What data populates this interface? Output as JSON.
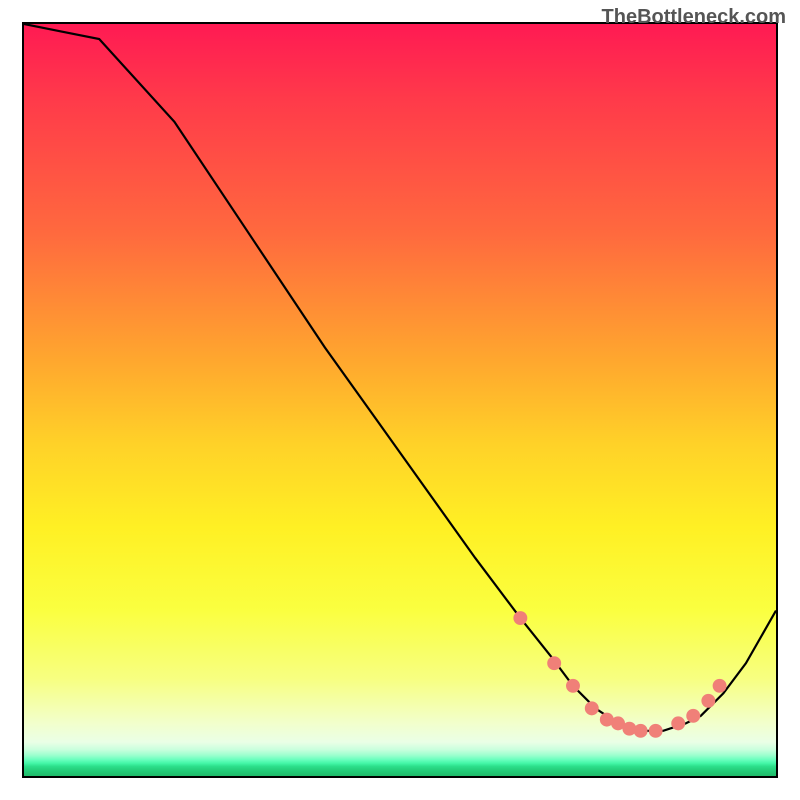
{
  "watermark": "TheBottleneck.com",
  "chart_data": {
    "type": "line",
    "title": "",
    "xlabel": "",
    "ylabel": "",
    "xlim": [
      0,
      100
    ],
    "ylim": [
      0,
      100
    ],
    "series": [
      {
        "name": "curve",
        "x": [
          0,
          5,
          10,
          20,
          30,
          40,
          50,
          60,
          66,
          70,
          73,
          76,
          79,
          82,
          85,
          88,
          90,
          93,
          96,
          100
        ],
        "y": [
          0,
          1,
          2,
          13,
          28,
          43,
          57,
          71,
          79,
          84,
          88,
          91,
          93,
          94,
          94,
          93,
          92,
          89,
          85,
          78
        ]
      }
    ],
    "markers": {
      "name": "dots",
      "x": [
        66,
        70.5,
        73,
        75.5,
        77.5,
        79,
        80.5,
        82,
        84,
        87,
        89,
        91,
        92.5
      ],
      "y": [
        79,
        85,
        88,
        91,
        92.5,
        93,
        93.7,
        94,
        94,
        93,
        92,
        90,
        88
      ]
    },
    "gradient_stops": [
      {
        "pos": 0,
        "color": "#ff1a53"
      },
      {
        "pos": 0.45,
        "color": "#ffa82e"
      },
      {
        "pos": 0.7,
        "color": "#fff024"
      },
      {
        "pos": 0.95,
        "color": "#eaffe6"
      },
      {
        "pos": 1.0,
        "color": "#20bb6a"
      }
    ]
  }
}
